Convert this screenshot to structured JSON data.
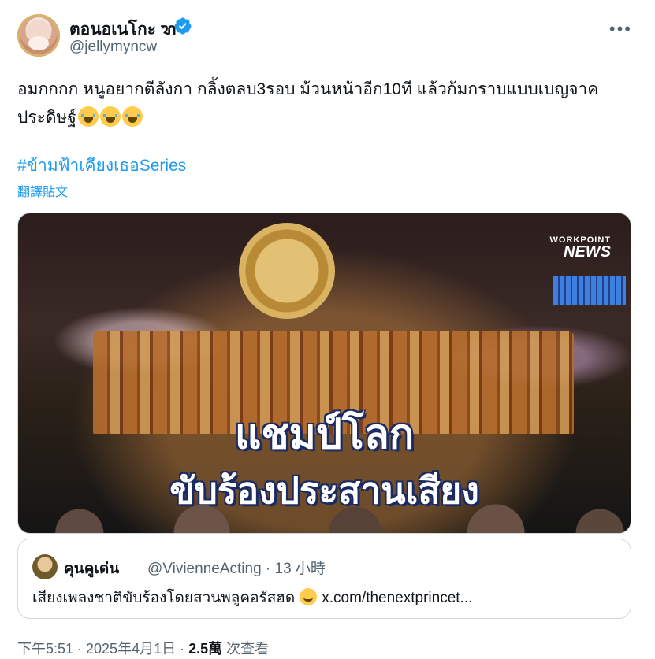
{
  "author": {
    "name": "ตอนอเนโกะ ꦫ",
    "handle": "@jellymyncw",
    "verified": true
  },
  "tweet": {
    "text": "อมกกกก หนูอยากตีลังกา กลิ้งตลบ3รอบ ม้วนหน้าอีก10ที แล้วก้มกราบแบบเบญจาคประดิษฐ์",
    "hashtag": "#ข้ามฟ้าเคียงเธอSeries",
    "translate_label": "翻譯貼文"
  },
  "media": {
    "brand_top": "WORKPOINT",
    "brand": "NEWS",
    "headline_1": "แชมป์โลก",
    "headline_2": "ขับร้องประสานเสียง"
  },
  "quote": {
    "name": "คุนคูเด่น",
    "handle": "@VivienneActing · 13 小時",
    "text_before": "เสียงเพลงชาติขับร้องโดยสวนพลูคอรัสฮด",
    "link": "x.com/thenextprincet..."
  },
  "footer": {
    "time": "下午5:51 · 2025年4月1日 · ",
    "views": "2.5萬",
    "views_label": " 次查看"
  },
  "colors": {
    "accent": "#1d9bf0",
    "secondary_text": "#536471"
  }
}
